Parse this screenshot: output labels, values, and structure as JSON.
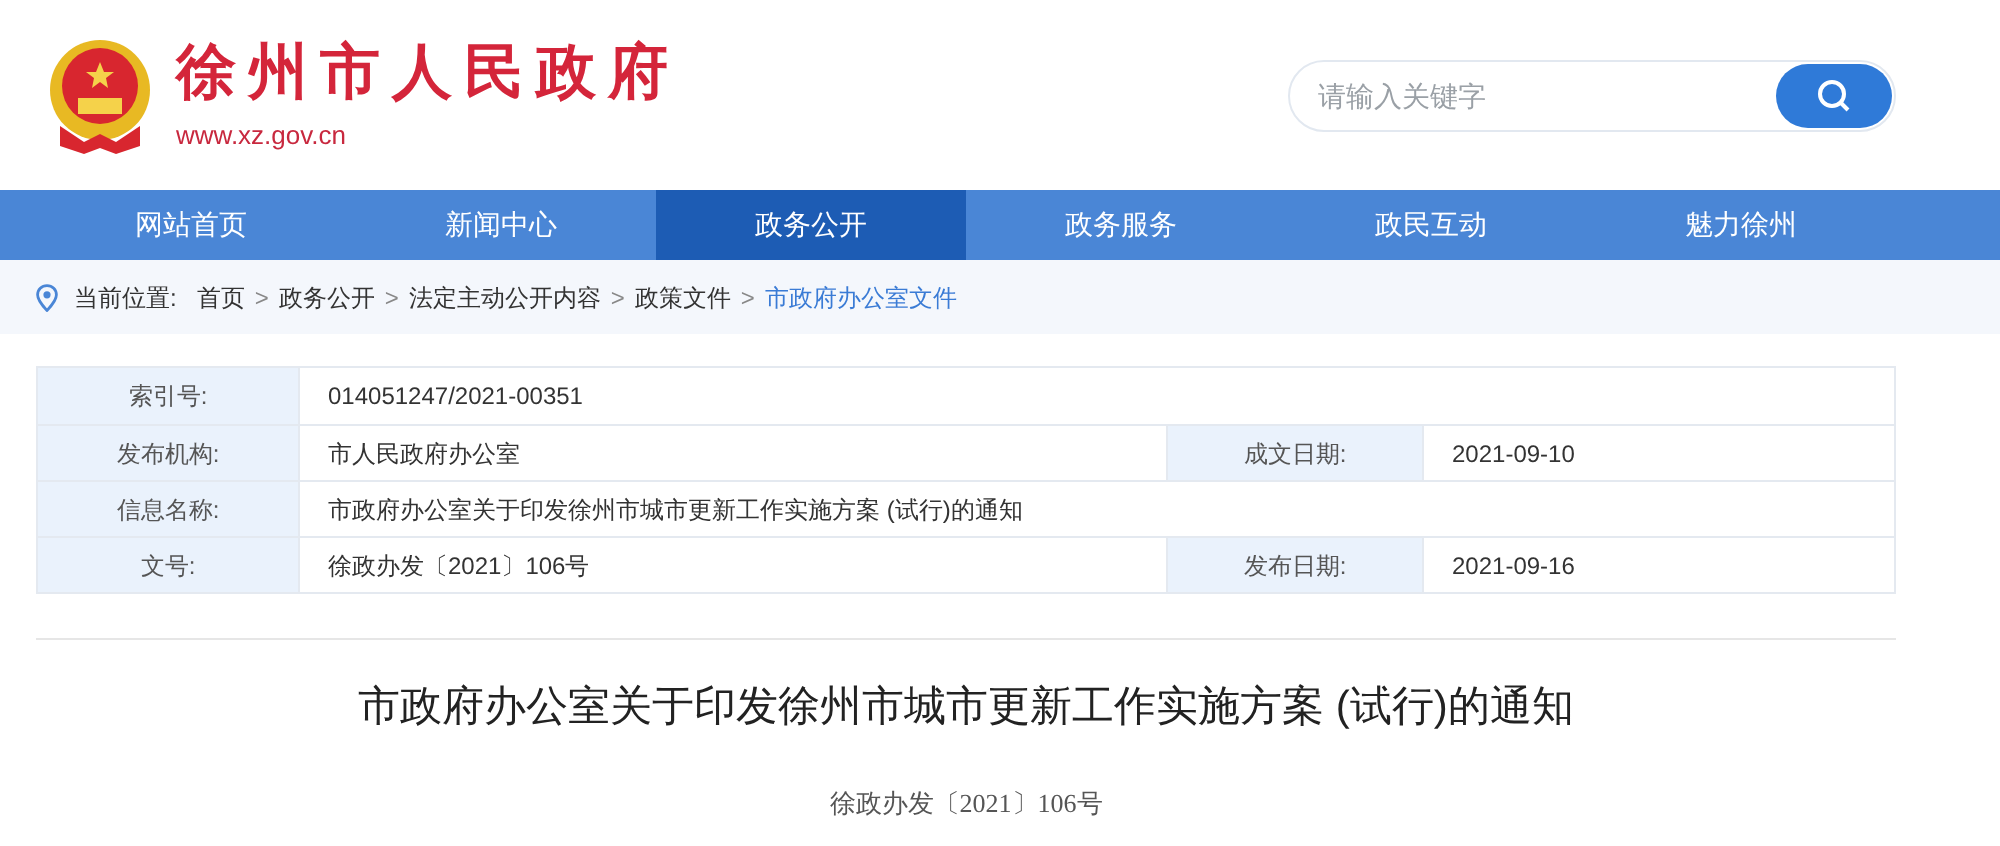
{
  "header": {
    "site_name": "徐州市人民政府",
    "site_url": "www.xz.gov.cn",
    "search": {
      "placeholder": "请输入关键字"
    }
  },
  "nav": [
    {
      "label": "网站首页",
      "selected": false
    },
    {
      "label": "新闻中心",
      "selected": false
    },
    {
      "label": "政务公开",
      "selected": true
    },
    {
      "label": "政务服务",
      "selected": false
    },
    {
      "label": "政民互动",
      "selected": false
    },
    {
      "label": "魅力徐州",
      "selected": false
    }
  ],
  "breadcrumb": {
    "label": "当前位置:",
    "items": [
      {
        "label": "首页",
        "current": false
      },
      {
        "label": "政务公开",
        "current": false
      },
      {
        "label": "法定主动公开内容",
        "current": false
      },
      {
        "label": "政策文件",
        "current": false
      },
      {
        "label": "市政府办公室文件",
        "current": true
      }
    ],
    "separator": ">"
  },
  "info_table": [
    {
      "label": "索引号:",
      "value": "014051247/2021-00351"
    },
    {
      "label": "发布机构:",
      "value": "市人民政府办公室",
      "label_2": "成文日期:",
      "value_2": "2021-09-10"
    },
    {
      "label": "信息名称:",
      "value": "市政府办公室关于印发徐州市城市更新工作实施方案 (试行)的通知"
    },
    {
      "label": "文号:",
      "value": "徐政办发〔2021〕106号",
      "label_2": "发布日期:",
      "value_2": "2021-09-16"
    }
  ],
  "article": {
    "title": "市政府办公室关于印发徐州市城市更新工作实施方案 (试行)的通知",
    "doc_number": "徐政办发〔2021〕106号"
  }
}
